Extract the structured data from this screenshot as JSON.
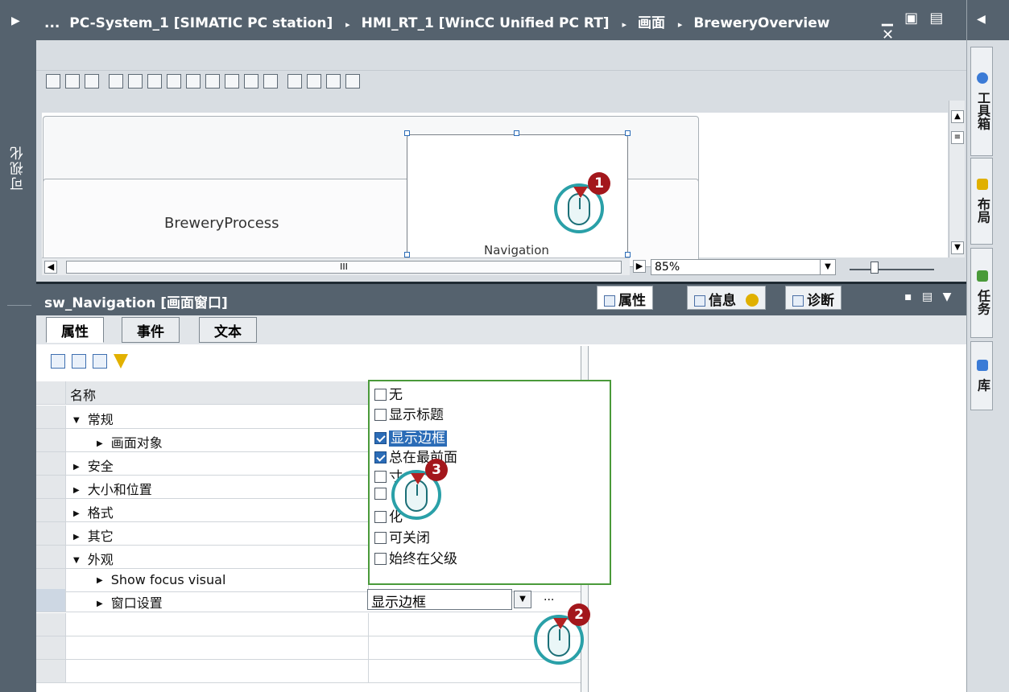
{
  "left_strip": {
    "label": "可视化",
    "arrow": "▶"
  },
  "title_bar": {
    "crumbs": [
      "...",
      "PC-System_1 [SIMATIC PC station]",
      "HMI_RT_1 [WinCC Unified PC RT]",
      "画面",
      "BreweryOverview"
    ],
    "separator": "▸",
    "window_buttons": "▁ ▣ ▤ ✕"
  },
  "right_strip": {
    "arrow": "◀",
    "tabs": [
      "工具箱",
      "布局",
      "任务",
      "库"
    ]
  },
  "canvas": {
    "screens": [
      "BreweryProcess",
      "Navigation"
    ],
    "zoom": "85%",
    "scroll_thumb": "III"
  },
  "inspector": {
    "title": "sw_Navigation [画面窗口]",
    "tabs": [
      "属性",
      "信息",
      "诊断"
    ],
    "sub_tabs": [
      "属性",
      "事件",
      "文本"
    ]
  },
  "property_grid": {
    "header": "名称",
    "rows": [
      {
        "label": "常规",
        "level": 0,
        "expanded": true
      },
      {
        "label": "画面对象",
        "level": 1,
        "expanded": false
      },
      {
        "label": "安全",
        "level": 0,
        "expanded": false
      },
      {
        "label": "大小和位置",
        "level": 0,
        "expanded": false
      },
      {
        "label": "格式",
        "level": 0,
        "expanded": false
      },
      {
        "label": "其它",
        "level": 0,
        "expanded": false
      },
      {
        "label": "外观",
        "level": 0,
        "expanded": true
      },
      {
        "label": "Show focus visual",
        "level": 1,
        "expanded": false
      },
      {
        "label": "窗口设置",
        "level": 1,
        "expanded": false
      }
    ],
    "window_settings_value": "显示边框",
    "ellipsis": "..."
  },
  "dropdown_options": [
    {
      "label": "无",
      "checked": false,
      "highlight": false
    },
    {
      "label": "显示标题",
      "checked": false,
      "highlight": false
    },
    {
      "label": "显示边框",
      "checked": true,
      "highlight": true
    },
    {
      "label": "总在最前面",
      "checked": true,
      "highlight": false
    },
    {
      "label": "寸",
      "checked": false,
      "highlight": false
    },
    {
      "label": "",
      "checked": false,
      "highlight": false
    },
    {
      "label": "化",
      "checked": false,
      "highlight": false
    },
    {
      "label": "可关闭",
      "checked": false,
      "highlight": false
    },
    {
      "label": "始终在父级",
      "checked": false,
      "highlight": false
    }
  ],
  "callouts": [
    "1",
    "2",
    "3"
  ],
  "colors": {
    "chrome_dark": "#55626e",
    "callout_ring": "#2aa0a8",
    "callout_badge": "#a3171c",
    "dropdown_border": "#4a9a3a",
    "selection": "#2b6cb7"
  }
}
